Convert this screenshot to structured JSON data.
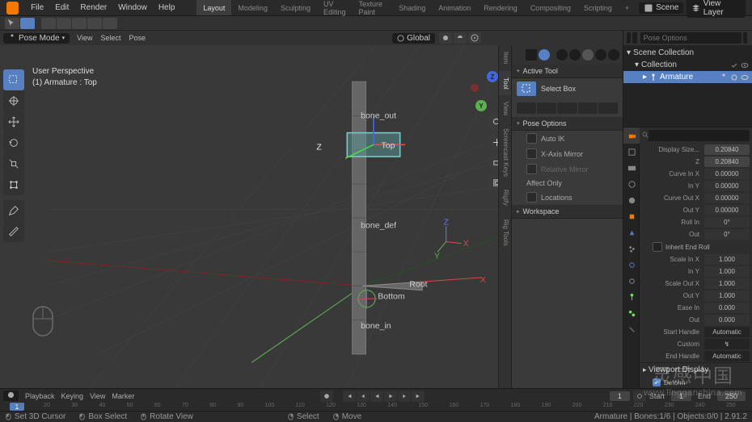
{
  "menu": {
    "items": [
      "File",
      "Edit",
      "Render",
      "Window",
      "Help"
    ]
  },
  "workspaces": [
    "Layout",
    "Modeling",
    "Sculpting",
    "UV Editing",
    "Texture Paint",
    "Shading",
    "Animation",
    "Rendering",
    "Compositing",
    "Scripting"
  ],
  "scene_name": "Scene",
  "view_layer": "View Layer",
  "header3d": {
    "mode": "Pose Mode",
    "view": "View",
    "select": "Select",
    "pose": "Pose",
    "orientation": "Global"
  },
  "vp_info": {
    "line1": "User Perspective",
    "line2": "(1) Armature : Top"
  },
  "nav_tabs": [
    "Item",
    "Tool",
    "View",
    "Screencast Keys",
    "Rigify",
    "Rig Tools"
  ],
  "active_tool": {
    "title": "Active Tool",
    "select": "Select Box"
  },
  "pose_options": {
    "title": "Pose Options",
    "auto_ik": "Auto IK",
    "x_mirror": "X-Axis Mirror",
    "rel_mirror": "Relative Mirror",
    "affect": "Affect Only",
    "locations": "Locations"
  },
  "workspace_panel": "Workspace",
  "outliner": {
    "scene_coll": "Scene Collection",
    "collection": "Collection",
    "armature": "Armature"
  },
  "props": {
    "display_size": "Display Size...",
    "display_size_v": "0.20840",
    "z": "Z",
    "z_v": "0.20840",
    "curve_in_x": "Curve In X",
    "curve_in_x_v": "0.00000",
    "in_y": "In Y",
    "in_y_v": "0.00000",
    "curve_out_x": "Curve Out X",
    "curve_out_x_v": "0.00000",
    "out_y": "Out Y",
    "out_y_v": "0.00000",
    "roll_in": "Roll In",
    "roll_in_v": "0°",
    "out": "Out",
    "out_v": "0°",
    "inherit": "Inherit End Roll",
    "scale_in_x": "Scale In X",
    "scale_in_x_v": "1.000",
    "in_y2": "In Y",
    "in_y2_v": "1.000",
    "scale_out_x": "Scale Out X",
    "scale_out_x_v": "1.000",
    "out_y2": "Out Y",
    "out_y2_v": "1.000",
    "ease_in": "Ease In",
    "ease_in_v": "0.000",
    "out2": "Out",
    "out2_v": "0.000",
    "start_handle": "Start Handle",
    "start_handle_v": "Automatic",
    "custom": "Custom",
    "end_handle": "End Handle",
    "end_handle_v": "Automatic",
    "viewport_display": "Viewport Display",
    "deform": "Deform"
  },
  "bone_labels": {
    "top": "Top",
    "bone_out": "bone_out",
    "bone_def": "bone_def",
    "root": "Root",
    "bottom": "Bottom",
    "bone_in": "bone_in"
  },
  "axes3d": {
    "x": "X",
    "y": "Y",
    "z": "Z"
  },
  "timeline": {
    "playback": "Playback",
    "keying": "Keying",
    "view": "View",
    "marker": "Marker",
    "frame": "1",
    "start_lbl": "Start",
    "start": "1",
    "end_lbl": "End",
    "end": "250",
    "ticks": [
      "10",
      "20",
      "30",
      "40",
      "50",
      "60",
      "70",
      "80",
      "90",
      "100",
      "110",
      "120",
      "130",
      "140",
      "150",
      "160",
      "170",
      "180",
      "190",
      "200",
      "210",
      "220",
      "230",
      "240",
      "250"
    ]
  },
  "status": {
    "set_cursor": "Set 3D Cursor",
    "box_select": "Box Select",
    "rotate": "Rotate View",
    "select": "Select",
    "move": "Move",
    "info": "Armature | Bones:1/6 | Objects:0/0 | 2.91.2"
  },
  "header_popup": "Pose Options",
  "chart_data": null,
  "watermark": {
    "cn": "灵感中国",
    "url": "www.lingganchina.com"
  }
}
